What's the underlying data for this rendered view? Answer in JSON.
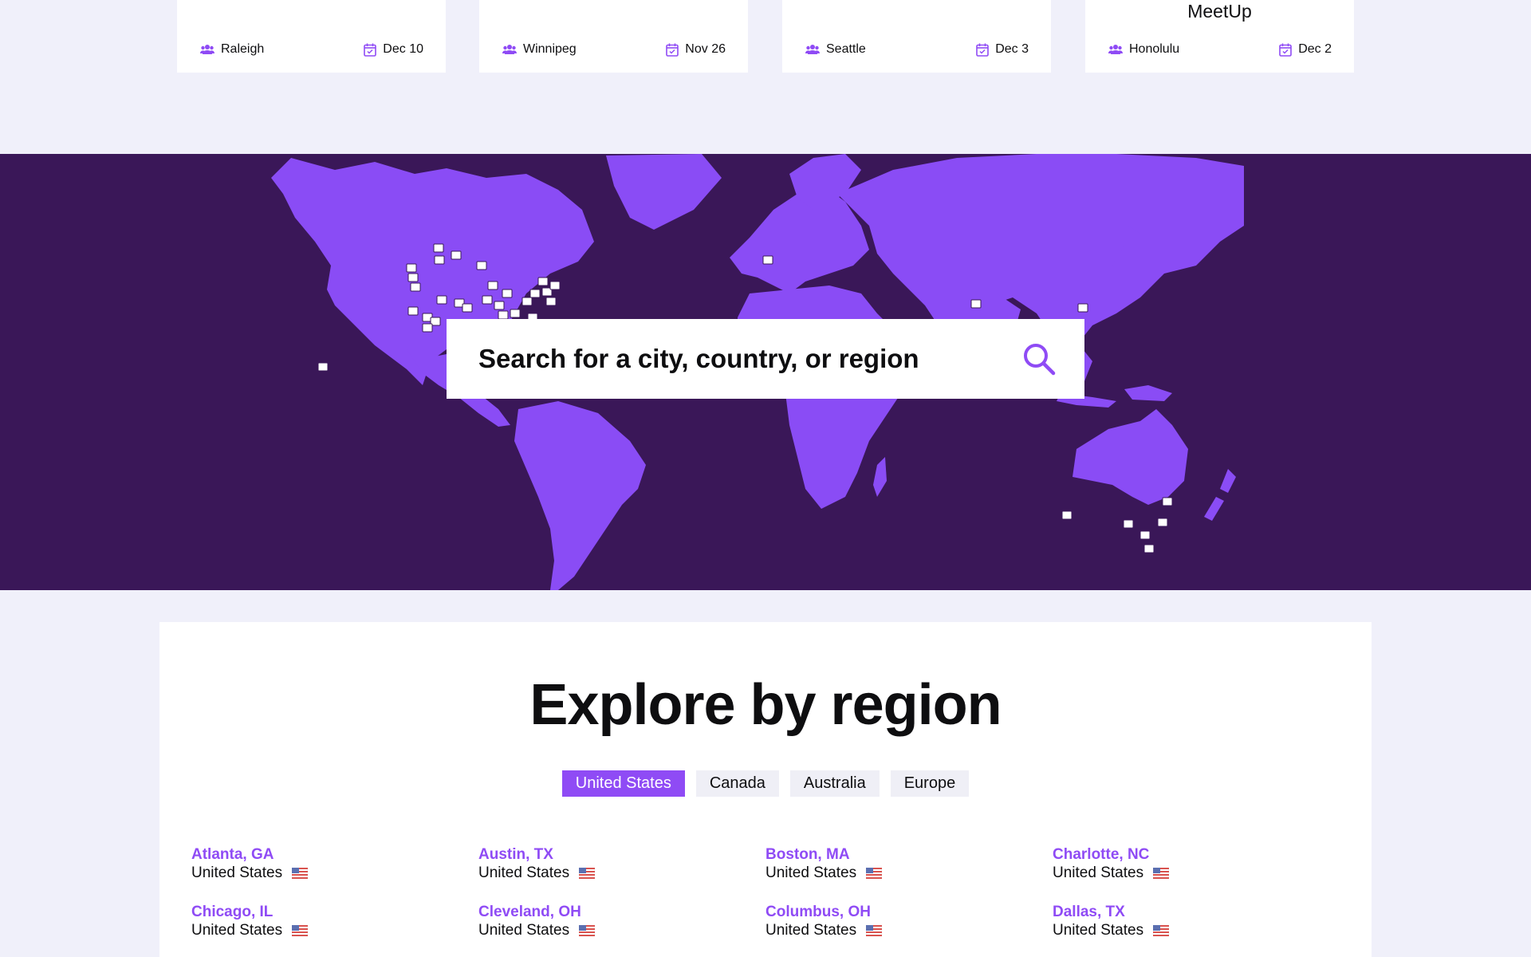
{
  "event_cards": [
    {
      "title": "",
      "city": "Raleigh",
      "date": "Dec 10"
    },
    {
      "title": "",
      "city": "Winnipeg",
      "date": "Nov 26"
    },
    {
      "title": "",
      "city": "Seattle",
      "date": "Dec 3"
    },
    {
      "title": "MeetUp",
      "city": "Honolulu",
      "date": "Dec 2"
    }
  ],
  "search": {
    "placeholder": "Search for a city, country, or region",
    "icon": "search-icon"
  },
  "explore": {
    "title": "Explore by region",
    "tabs": [
      {
        "label": "United States",
        "active": true
      },
      {
        "label": "Canada",
        "active": false
      },
      {
        "label": "Australia",
        "active": false
      },
      {
        "label": "Europe",
        "active": false
      }
    ],
    "cities": [
      {
        "name": "Atlanta, GA",
        "country": "United States"
      },
      {
        "name": "Austin, TX",
        "country": "United States"
      },
      {
        "name": "Boston, MA",
        "country": "United States"
      },
      {
        "name": "Charlotte, NC",
        "country": "United States"
      },
      {
        "name": "Chicago, IL",
        "country": "United States"
      },
      {
        "name": "Cleveland, OH",
        "country": "United States"
      },
      {
        "name": "Columbus, OH",
        "country": "United States"
      },
      {
        "name": "Dallas, TX",
        "country": "United States"
      }
    ]
  },
  "colors": {
    "accent": "#8f4bf5",
    "map_background": "#3a1758",
    "land": "#8a4cf5",
    "page_background": "#f0f0fa"
  }
}
